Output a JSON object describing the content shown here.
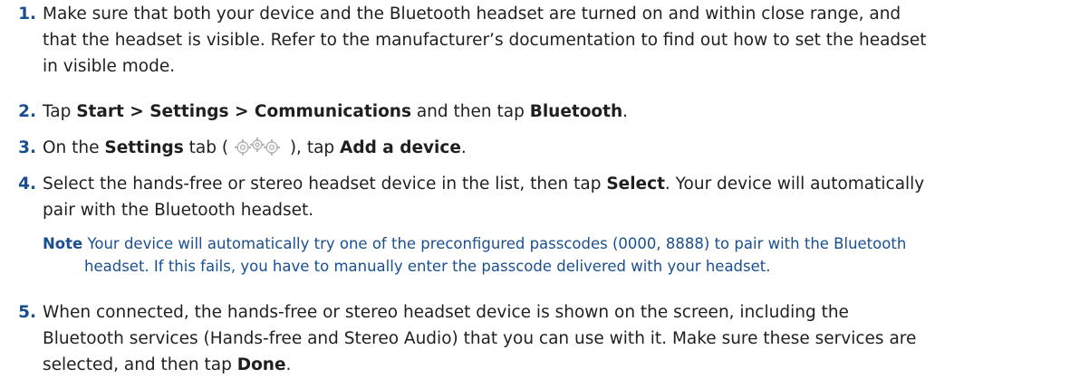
{
  "steps": [
    {
      "number": "1.",
      "lines": [
        "Make sure that both your device and the Bluetooth headset are turned on and within close range, and",
        "that the headset is visible. Refer to the manufacturer’s documentation to find out how to set the headset",
        "in visible mode."
      ]
    },
    {
      "number": "2.",
      "t1": "Tap ",
      "b1": "Start > Settings > Communications",
      "t2": " and then tap ",
      "b2": "Bluetooth",
      "t3": "."
    },
    {
      "number": "3.",
      "t1": "On the ",
      "b1": "Settings",
      "t2": " tab ( ",
      "icon": "settings-gears-icon",
      "t3": " ), tap ",
      "b2": "Add a device",
      "t4": "."
    },
    {
      "number": "4.",
      "t1": "Select the hands-free or stereo headset device in the list, then tap ",
      "b1": "Select",
      "t2": ". Your device will automatically",
      "line2": "pair with the Bluetooth headset.",
      "note": {
        "label": "Note",
        "line1": "Your device will automatically try one of the preconfigured passcodes (0000, 8888) to pair with the Bluetooth",
        "line2": "headset. If this fails, you have to manually enter the passcode delivered with your headset."
      }
    },
    {
      "number": "5.",
      "line1": "When connected, the hands-free or stereo headset device is shown on the screen, including the",
      "line2": "Bluetooth services (Hands-free and Stereo Audio) that you can use with it. Make sure these services are",
      "t1": "selected, and then tap ",
      "b1": "Done",
      "t2": "."
    }
  ],
  "colors": {
    "accent": "#1a4f8f",
    "text": "#1f1f1f"
  }
}
